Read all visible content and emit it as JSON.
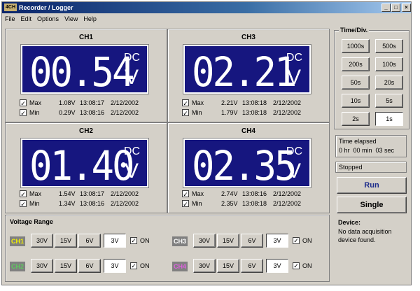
{
  "window": {
    "icon_text": "4CH",
    "title": "Recorder / Logger",
    "min": "_",
    "max": "□",
    "close": "×"
  },
  "menu": [
    "File",
    "Edit",
    "Options",
    "View",
    "Help"
  ],
  "channels": [
    {
      "name": "CH1",
      "reading": "00.54",
      "mode": "DC",
      "unit": "V",
      "max_label": "Max",
      "max_value": "1.08V",
      "max_time": "13:08:17",
      "max_date": "2/12/2002",
      "min_label": "Min",
      "min_value": "0.29V",
      "min_time": "13:08:16",
      "min_date": "2/12/2002"
    },
    {
      "name": "CH3",
      "reading": "02.21",
      "mode": "DC",
      "unit": "V",
      "max_label": "Max",
      "max_value": "2.21V",
      "max_time": "13:08:18",
      "max_date": "2/12/2002",
      "min_label": "Min",
      "min_value": "1.79V",
      "min_time": "13:08:18",
      "min_date": "2/12/2002"
    },
    {
      "name": "CH2",
      "reading": "01.40",
      "mode": "DC",
      "unit": "V",
      "max_label": "Max",
      "max_value": "1.54V",
      "max_time": "13:08:17",
      "max_date": "2/12/2002",
      "min_label": "Min",
      "min_value": "1.34V",
      "min_time": "13:08:16",
      "min_date": "2/12/2002"
    },
    {
      "name": "CH4",
      "reading": "02.35",
      "mode": "DC",
      "unit": "V",
      "max_label": "Max",
      "max_value": "2.74V",
      "max_time": "13:08:16",
      "max_date": "2/12/2002",
      "min_label": "Min",
      "min_value": "2.35V",
      "min_time": "13:08:18",
      "min_date": "2/12/2002"
    }
  ],
  "check_mark": "✓",
  "voltage_range": {
    "title": "Voltage Range",
    "options": [
      "30V",
      "15V",
      "6V",
      "3V"
    ],
    "selected": "3V",
    "on_label": "ON",
    "rows": [
      {
        "tag": "CH1",
        "color": "#f0f000"
      },
      {
        "tag": "CH3",
        "color": "#ffffff"
      },
      {
        "tag": "CH2",
        "color": "#5ec85e"
      },
      {
        "tag": "CH4",
        "color": "#e060e0"
      }
    ]
  },
  "time_div": {
    "title": "Time/Div.",
    "buttons": [
      "1000s",
      "500s",
      "200s",
      "100s",
      "50s",
      "20s",
      "10s",
      "5s",
      "2s",
      "1s"
    ],
    "selected": "1s"
  },
  "elapsed": {
    "label": "Time elapsed",
    "value": "0 hr  00 min  03 sec"
  },
  "status": "Stopped",
  "run_label": "Run",
  "single_label": "Single",
  "device": {
    "title": "Device:",
    "message": "No data acquisition device found."
  }
}
